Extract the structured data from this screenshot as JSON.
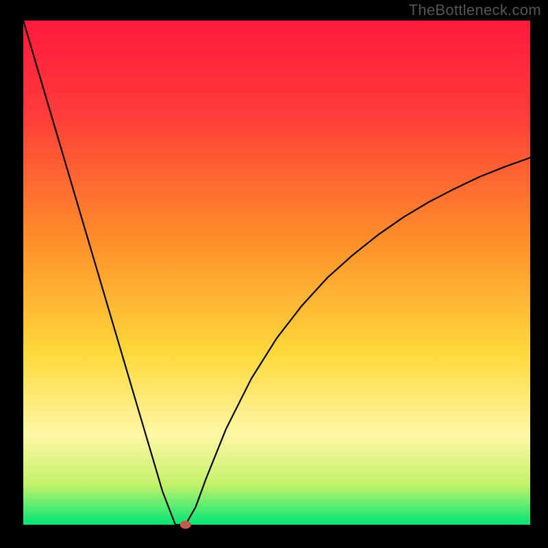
{
  "watermark": "TheBottleneck.com",
  "chart_data": {
    "type": "line",
    "title": "",
    "xlabel": "",
    "ylabel": "",
    "xlim": [
      0,
      100
    ],
    "ylim": [
      0,
      100
    ],
    "grid": false,
    "legend": false,
    "annotations": [],
    "colors": {
      "gradient_top": "#ff1a3d",
      "gradient_mid": "#ffd93a",
      "gradient_bottom": "#00e676",
      "curve": "#000000",
      "marker": "#c25a4a",
      "frame": "#000000"
    },
    "series": [
      {
        "name": "bottleneck-curve",
        "x": [
          0.0,
          2.5,
          5.0,
          7.5,
          10.0,
          12.5,
          15.0,
          17.5,
          20.0,
          22.5,
          25.0,
          27.5,
          30.0,
          31.0,
          32.0,
          34.0,
          36.0,
          40.0,
          45.0,
          50.0,
          55.0,
          60.0,
          65.0,
          70.0,
          75.0,
          80.0,
          85.0,
          90.0,
          95.0,
          100.0
        ],
        "y": [
          100.0,
          91.5,
          83.0,
          74.5,
          66.0,
          57.5,
          49.0,
          40.5,
          32.0,
          23.5,
          15.0,
          6.5,
          0.0,
          0.0,
          0.0,
          3.5,
          9.0,
          19.0,
          29.0,
          37.0,
          43.5,
          49.0,
          53.5,
          57.5,
          61.0,
          64.0,
          66.6,
          69.0,
          71.0,
          72.8
        ]
      }
    ],
    "marker": {
      "x": 32.0,
      "y": 0.0,
      "kind": "optimum-dot"
    }
  }
}
